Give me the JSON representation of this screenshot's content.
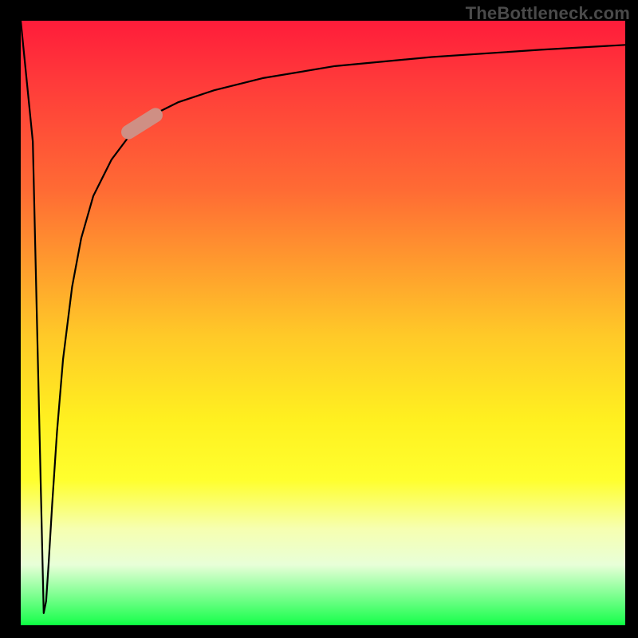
{
  "attribution": "TheBottleneck.com",
  "chart_data": {
    "type": "line",
    "title": "",
    "xlabel": "",
    "ylabel": "",
    "xlim": [
      0,
      100
    ],
    "ylim": [
      0,
      100
    ],
    "series": [
      {
        "name": "curve",
        "x": [
          0,
          2,
          3.8,
          4.2,
          4.6,
          5.2,
          6.0,
          7.0,
          8.5,
          10,
          12,
          15,
          18,
          22,
          26,
          32,
          40,
          52,
          68,
          86,
          100
        ],
        "values": [
          100,
          80,
          2,
          4,
          10,
          20,
          32,
          44,
          56,
          64,
          71,
          77,
          81,
          84.5,
          86.5,
          88.5,
          90.5,
          92.5,
          94,
          95.2,
          96
        ]
      }
    ],
    "marker": {
      "x": 20,
      "y": 83,
      "angle_deg": -32
    },
    "background_gradient": {
      "top": "#ff1c3a",
      "bottom": "#0aff3f"
    }
  }
}
